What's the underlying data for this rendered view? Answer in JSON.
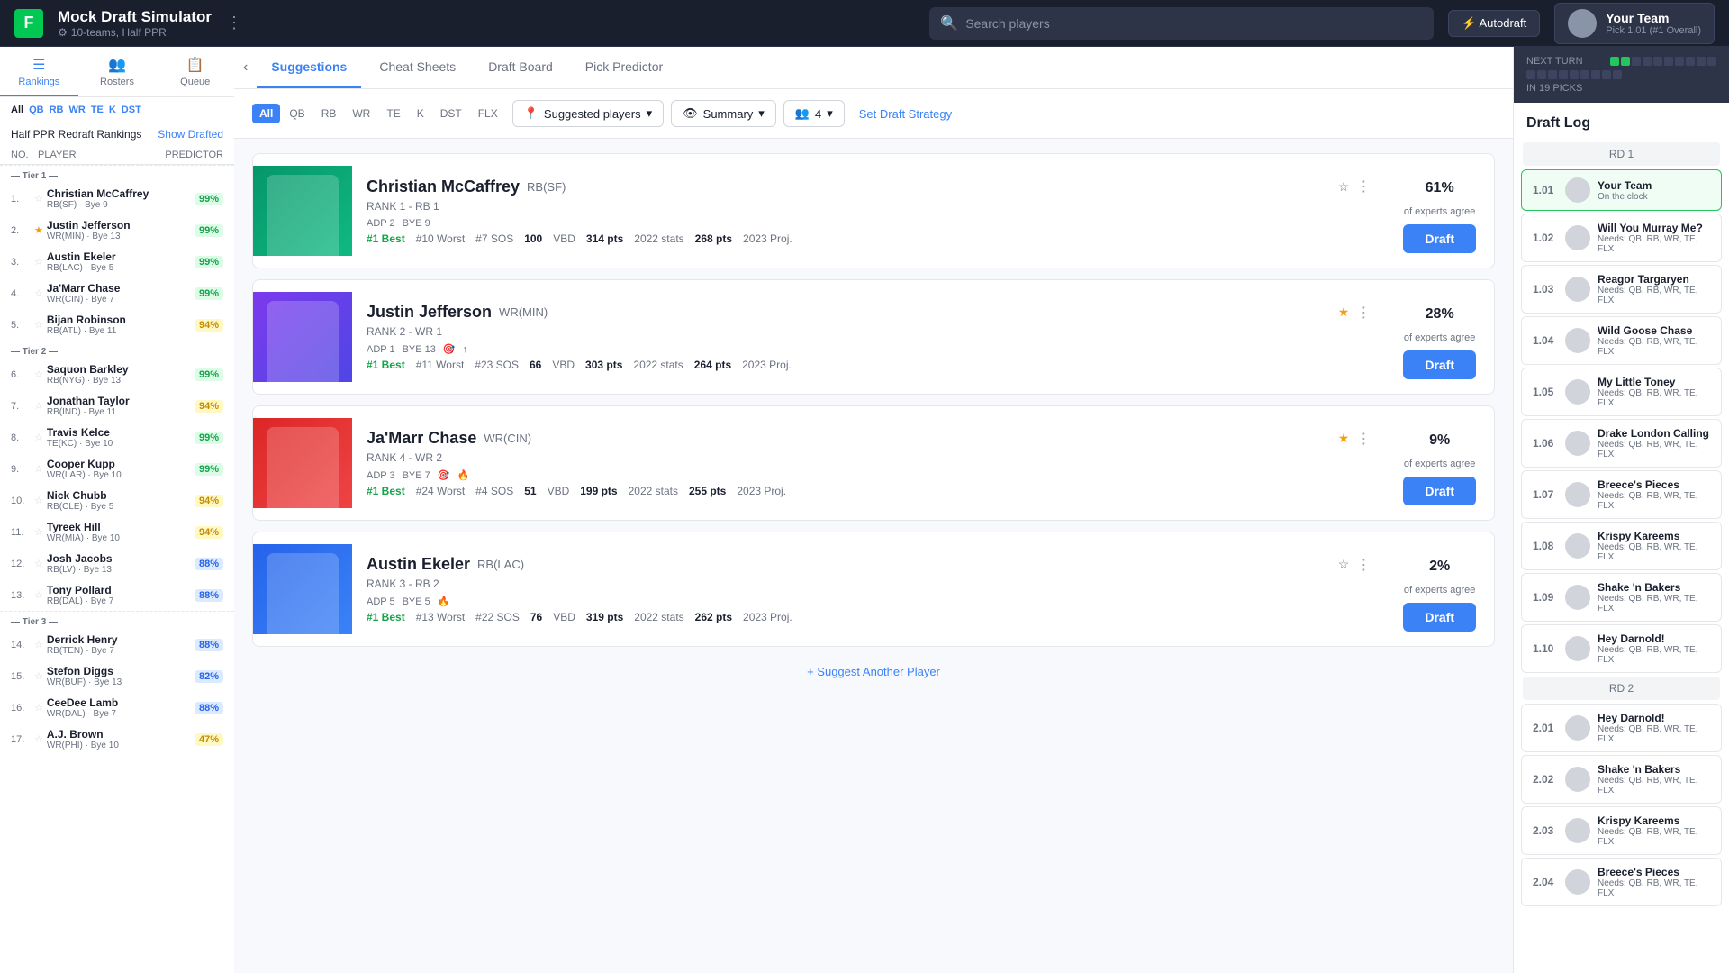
{
  "app": {
    "title": "Mock Draft Simulator",
    "subtitle": "10-teams, Half PPR",
    "logo": "F"
  },
  "search": {
    "placeholder": "Search players"
  },
  "autodraft": {
    "label": "⚡ Autodraft"
  },
  "your_team": {
    "name": "Your Team",
    "pick": "Pick 1.01 (#1 Overall)"
  },
  "left_nav": [
    {
      "label": "Rankings",
      "icon": "☰",
      "active": true
    },
    {
      "label": "Rosters",
      "icon": "👥",
      "active": false
    },
    {
      "label": "Queue",
      "icon": "📋",
      "active": false
    }
  ],
  "pos_filters": [
    "All",
    "QB",
    "RB",
    "WR",
    "TE",
    "K",
    "DST"
  ],
  "rankings_dropdown": "Half PPR Redraft Rankings",
  "show_drafted": "Show Drafted",
  "col_headers": {
    "no": "NO.",
    "player": "PLAYER",
    "predictor": "PREDICTOR"
  },
  "tiers": [
    {
      "label": "Tier 1",
      "players": [
        {
          "num": 1,
          "name": "Christian McCaffrey",
          "pos": "RB(SF)",
          "bye": "Bye 9",
          "badge": "99%",
          "badge_color": "green",
          "star": false,
          "icons": ""
        },
        {
          "num": 2,
          "name": "Justin Jefferson",
          "pos": "WR(MIN)",
          "bye": "Bye 13",
          "badge": "99%",
          "badge_color": "green",
          "star": true,
          "icons": "🎯↑"
        },
        {
          "num": 3,
          "name": "Austin Ekeler",
          "pos": "RB(LAC)",
          "bye": "Bye 5",
          "badge": "99%",
          "badge_color": "green",
          "star": false,
          "icons": "🔥"
        },
        {
          "num": 4,
          "name": "Ja'Marr Chase",
          "pos": "WR(CIN)",
          "bye": "Bye 7",
          "badge": "99%",
          "badge_color": "green",
          "star": false,
          "icons": "🎯"
        },
        {
          "num": 5,
          "name": "Bijan Robinson",
          "pos": "RB(ATL)",
          "bye": "Bye 11",
          "badge": "94%",
          "badge_color": "yellow",
          "star": false,
          "icons": "🔵🆕"
        }
      ]
    },
    {
      "label": "Tier 2",
      "players": [
        {
          "num": 6,
          "name": "Saquon Barkley",
          "pos": "RB(NYG)",
          "bye": "Bye 13",
          "badge": "99%",
          "badge_color": "green",
          "star": false,
          "icons": "↑🎯"
        },
        {
          "num": 7,
          "name": "Jonathan Taylor",
          "pos": "RB(IND)",
          "bye": "Bye 11",
          "badge": "94%",
          "badge_color": "yellow",
          "star": false,
          "icons": "❄️🔴"
        },
        {
          "num": 8,
          "name": "Travis Kelce",
          "pos": "TE(KC)",
          "bye": "Bye 10",
          "badge": "99%",
          "badge_color": "green",
          "star": false,
          "icons": "🔥"
        },
        {
          "num": 9,
          "name": "Cooper Kupp",
          "pos": "WR(LAR)",
          "bye": "Bye 10",
          "badge": "99%",
          "badge_color": "green",
          "star": false,
          "icons": ""
        },
        {
          "num": 10,
          "name": "Nick Chubb",
          "pos": "RB(CLE)",
          "bye": "Bye 5",
          "badge": "94%",
          "badge_color": "yellow",
          "star": false,
          "icons": "🚫"
        },
        {
          "num": 11,
          "name": "Tyreek Hill",
          "pos": "WR(MIA)",
          "bye": "Bye 10",
          "badge": "94%",
          "badge_color": "yellow",
          "star": false,
          "icons": "🔥🔥🎯"
        },
        {
          "num": 12,
          "name": "Josh Jacobs",
          "pos": "RB(LV)",
          "bye": "Bye 13",
          "badge": "88%",
          "badge_color": "blue",
          "star": false,
          "icons": ""
        },
        {
          "num": 13,
          "name": "Tony Pollard",
          "pos": "RB(DAL)",
          "bye": "Bye 7",
          "badge": "88%",
          "badge_color": "blue",
          "star": false,
          "icons": "↑⬆"
        }
      ]
    },
    {
      "label": "Tier 3",
      "players": [
        {
          "num": 14,
          "name": "Derrick Henry",
          "pos": "RB(TEN)",
          "bye": "Bye 7",
          "badge": "88%",
          "badge_color": "blue",
          "star": false,
          "icons": "❄️"
        },
        {
          "num": 15,
          "name": "Stefon Diggs",
          "pos": "WR(BUF)",
          "bye": "Bye 13",
          "badge": "82%",
          "badge_color": "blue",
          "star": false,
          "icons": ""
        },
        {
          "num": 16,
          "name": "CeeDee Lamb",
          "pos": "WR(DAL)",
          "bye": "Bye 7",
          "badge": "88%",
          "badge_color": "blue",
          "star": false,
          "icons": "↑"
        },
        {
          "num": 17,
          "name": "A.J. Brown",
          "pos": "WR(PHI)",
          "bye": "Bye 10",
          "badge": "47%",
          "badge_color": "yellow",
          "star": false,
          "icons": "🔥"
        }
      ]
    }
  ],
  "center_tabs": [
    "Suggestions",
    "Cheat Sheets",
    "Draft Board",
    "Pick Predictor"
  ],
  "center_active_tab": "Suggestions",
  "filter_pos": [
    "All",
    "QB",
    "RB",
    "WR",
    "TE",
    "K",
    "DST",
    "FLX"
  ],
  "suggested_players_label": "Suggested players",
  "summary_label": "Summary",
  "team_size_label": "4",
  "set_draft_strategy": "Set Draft Strategy",
  "suggestion_cards": [
    {
      "name": "Christian McCaffrey",
      "pos": "RB(SF)",
      "rank_label": "RANK 1 - RB 1",
      "adp": "ADP 2",
      "bye": "BYE 9",
      "badges": [
        "#1 Best",
        "#10 Worst",
        "#7 SOS",
        "100 VBD",
        "314 pts 2022 stats",
        "268 pts 2023 Proj."
      ],
      "expert_pct": "61",
      "expert_label": "of experts agree",
      "draft_label": "Draft",
      "star": false,
      "img_color": "green",
      "icons": []
    },
    {
      "name": "Justin Jefferson",
      "pos": "WR(MIN)",
      "rank_label": "RANK 2 - WR 1",
      "adp": "ADP 1",
      "bye": "BYE 13",
      "badges": [
        "#1 Best",
        "#11 Worst",
        "#23 SOS",
        "66 VBD",
        "303 pts 2022 stats",
        "264 pts 2023 Proj."
      ],
      "expert_pct": "28",
      "expert_label": "of experts agree",
      "draft_label": "Draft",
      "star": true,
      "img_color": "purple",
      "icons": [
        "🎯",
        "↑"
      ]
    },
    {
      "name": "Ja'Marr Chase",
      "pos": "WR(CIN)",
      "rank_label": "RANK 4 - WR 2",
      "adp": "ADP 3",
      "bye": "BYE 7",
      "badges": [
        "#1 Best",
        "#24 Worst",
        "#4 SOS",
        "51 VBD",
        "199 pts 2022 stats",
        "255 pts 2023 Proj."
      ],
      "expert_pct": "9",
      "expert_label": "of experts agree",
      "draft_label": "Draft",
      "star": true,
      "img_color": "red",
      "icons": [
        "🎯",
        "🔥"
      ]
    },
    {
      "name": "Austin Ekeler",
      "pos": "RB(LAC)",
      "rank_label": "RANK 3 - RB 2",
      "adp": "ADP 5",
      "bye": "BYE 5",
      "badges": [
        "#1 Best",
        "#13 Worst",
        "#22 SOS",
        "76 VBD",
        "319 pts 2022 stats",
        "262 pts 2023 Proj."
      ],
      "expert_pct": "2",
      "expert_label": "of experts agree",
      "draft_label": "Draft",
      "star": false,
      "img_color": "blue",
      "icons": [
        "🔥"
      ]
    }
  ],
  "suggest_another": "+ Suggest Another Player",
  "right_panel": {
    "next_turn_label": "NEXT TURN",
    "picks_label": "IN 19 PICKS",
    "draft_log_title": "Draft Log",
    "rounds": [
      {
        "label": "RD 1",
        "picks": [
          {
            "pick": "1.01",
            "team": "Your Team",
            "needs": "On the clock",
            "active": true
          },
          {
            "pick": "1.02",
            "team": "Will You Murray Me?",
            "needs": "Needs: QB, RB, WR, TE, FLX",
            "active": false
          },
          {
            "pick": "1.03",
            "team": "Reagor Targaryen",
            "needs": "Needs: QB, RB, WR, TE, FLX",
            "active": false
          },
          {
            "pick": "1.04",
            "team": "Wild Goose Chase",
            "needs": "Needs: QB, RB, WR, TE, FLX",
            "active": false
          },
          {
            "pick": "1.05",
            "team": "My Little Toney",
            "needs": "Needs: QB, RB, WR, TE, FLX",
            "active": false
          },
          {
            "pick": "1.06",
            "team": "Drake London Calling",
            "needs": "Needs: QB, RB, WR, TE, FLX",
            "active": false
          },
          {
            "pick": "1.07",
            "team": "Breece's Pieces",
            "needs": "Needs: QB, RB, WR, TE, FLX",
            "active": false
          },
          {
            "pick": "1.08",
            "team": "Krispy Kareems",
            "needs": "Needs: QB, RB, WR, TE, FLX",
            "active": false
          },
          {
            "pick": "1.09",
            "team": "Shake 'n Bakers",
            "needs": "Needs: QB, RB, WR, TE, FLX",
            "active": false
          },
          {
            "pick": "1.10",
            "team": "Hey Darnold!",
            "needs": "Needs: QB, RB, WR, TE, FLX",
            "active": false
          }
        ]
      },
      {
        "label": "RD 2",
        "picks": [
          {
            "pick": "2.01",
            "team": "Hey Darnold!",
            "needs": "Needs: QB, RB, WR, TE, FLX",
            "active": false
          },
          {
            "pick": "2.02",
            "team": "Shake 'n Bakers",
            "needs": "Needs: QB, RB, WR, TE, FLX",
            "active": false
          },
          {
            "pick": "2.03",
            "team": "Krispy Kareems",
            "needs": "Needs: QB, RB, WR, TE, FLX",
            "active": false
          },
          {
            "pick": "2.04",
            "team": "Breece's Pieces",
            "needs": "Needs: QB, RB, WR, TE, FLX",
            "active": false
          }
        ]
      }
    ]
  }
}
